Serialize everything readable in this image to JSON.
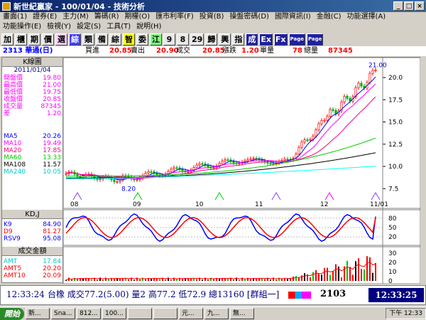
{
  "window": {
    "title": "新世紀贏家 - 100/01/04 - 技術分析",
    "controls": [
      "_",
      "□",
      "×"
    ]
  },
  "menu": [
    "畫面(1)",
    "證券(E)",
    "主力(M)",
    "籌碼(R)",
    "期權(O)",
    "匯市利率(F)",
    "投資(B)",
    "操盤密碼(D)",
    "國際資訊(I)",
    "金融(C)",
    "功能選擇(A)",
    "功能操作(E)",
    "檢視(Y)",
    "設定(S)",
    "工具(T)",
    "說明(H)"
  ],
  "toolbar": [
    {
      "label": "加",
      "color": "#000000"
    },
    {
      "label": "櫃",
      "color": "#000000"
    },
    {
      "label": "期",
      "color": "#000000"
    },
    {
      "label": "價",
      "color": "#000000"
    },
    {
      "label": "選",
      "color": "#000000"
    },
    {
      "label": "綜",
      "color": "#ffffff"
    },
    {
      "label": "類",
      "color": "#000000"
    },
    {
      "label": "備",
      "color": "#000000"
    },
    {
      "label": "綜",
      "color": "#000000"
    },
    {
      "label": "智",
      "color": "#000000"
    },
    {
      "label": "委",
      "color": "#000000"
    },
    {
      "label": "江",
      "color": "#000000"
    },
    {
      "label": "9",
      "color": "#000000"
    },
    {
      "label": "8",
      "color": "#000000"
    },
    {
      "label": "29",
      "color": "#000000"
    },
    {
      "label": "歸",
      "color": "#000000"
    },
    {
      "label": "興",
      "color": "#000000"
    },
    {
      "label": "指",
      "color": "#000000"
    },
    {
      "label": "成",
      "color": "#ffffff"
    },
    {
      "label": "Ex",
      "color": "#ffffff"
    },
    {
      "label": "Fx",
      "color": "#ffffff"
    },
    {
      "label": "Page",
      "color": "#ffffff"
    },
    {
      "label": "Page",
      "color": "#ffffff"
    }
  ],
  "infobar": {
    "stock": "2313 華通(日)",
    "bid_label": "買進",
    "bid": "20.85",
    "ask_label": "賣出",
    "ask": "20.90",
    "last_label": "成交",
    "last": "20.85",
    "change_label": "漲跌",
    "change": "1.20",
    "vol_label": "單量",
    "vol": "78",
    "tvol_label": "總量",
    "tvol": "87345"
  },
  "colors": {
    "up": "#ff0000",
    "down": "#00aa00",
    "ma5": "#0000ff",
    "ma10": "#ff00ff",
    "ma20": "#ff0080",
    "ma60": "#00cc00",
    "ma108": "#000000",
    "ma240": "#00ffff"
  },
  "left": {
    "kpanel": "K線圖",
    "date": "2011/01/04",
    "ohlc": [
      {
        "label": "開盤價",
        "value": "19.80"
      },
      {
        "label": "最高價",
        "value": "21.00"
      },
      {
        "label": "最低價",
        "value": "19.75"
      },
      {
        "label": "收盤價",
        "value": "20.85"
      },
      {
        "label": "成交量",
        "value": "87345"
      },
      {
        "label": "差",
        "value": "1.20"
      }
    ],
    "ma": [
      {
        "label": "MA5",
        "value": "20.26",
        "color": "#0000ff"
      },
      {
        "label": "MA10",
        "value": "19.49",
        "color": "#ff00ff"
      },
      {
        "label": "MA20",
        "value": "17.85",
        "color": "#ff0080"
      },
      {
        "label": "MA60",
        "value": "13.33",
        "color": "#00cc00"
      },
      {
        "label": "MA108",
        "value": "11.57",
        "color": "#000000"
      },
      {
        "label": "MA240",
        "value": "10.05",
        "color": "#00cccc"
      }
    ],
    "kdpanel": "KD,J",
    "kd": [
      {
        "label": "K9",
        "value": "84.90",
        "color": "#0000ff"
      },
      {
        "label": "D9",
        "value": "81.27",
        "color": "#ff0000"
      },
      {
        "label": "RSV9",
        "value": "95.08",
        "color": "#0000ff"
      }
    ],
    "volpanel": "成交金額",
    "amt": [
      {
        "label": "AMT",
        "value": "17.84",
        "color": "#00cccc"
      },
      {
        "label": "AMT5",
        "value": "20.20",
        "color": "#ff0000"
      },
      {
        "label": "AMT10",
        "value": "20.09",
        "color": "#ff0000"
      }
    ]
  },
  "chart_data": {
    "type": "candlestick",
    "x_labels": [
      "08",
      "09",
      "10",
      "11",
      "12",
      "11/01"
    ],
    "price_ticks": [
      "7.5",
      "10.0",
      "12.5",
      "15.0",
      "17.5",
      "20.0"
    ],
    "price_range": [
      6.8,
      21.6
    ],
    "annotations": {
      "high": "21.00",
      "low": "8.20"
    },
    "kd_ticks": [
      "80",
      "50",
      "20"
    ],
    "amt_ticks": [
      "30",
      "20",
      "10",
      "0"
    ]
  },
  "status": {
    "time": "12:33:24",
    "text": "台橡 成交77.2(5.00) 量2 高77.2 低72.9 總13160 [群組一]",
    "code": "2103",
    "clock": "12:33:25"
  },
  "taskbar": {
    "start": "開始",
    "tasks": [
      "新...",
      "Sna...",
      "812...",
      "100...",
      "",
      "",
      "元...",
      "九...",
      "無..."
    ],
    "tray": "下午 12:33"
  }
}
